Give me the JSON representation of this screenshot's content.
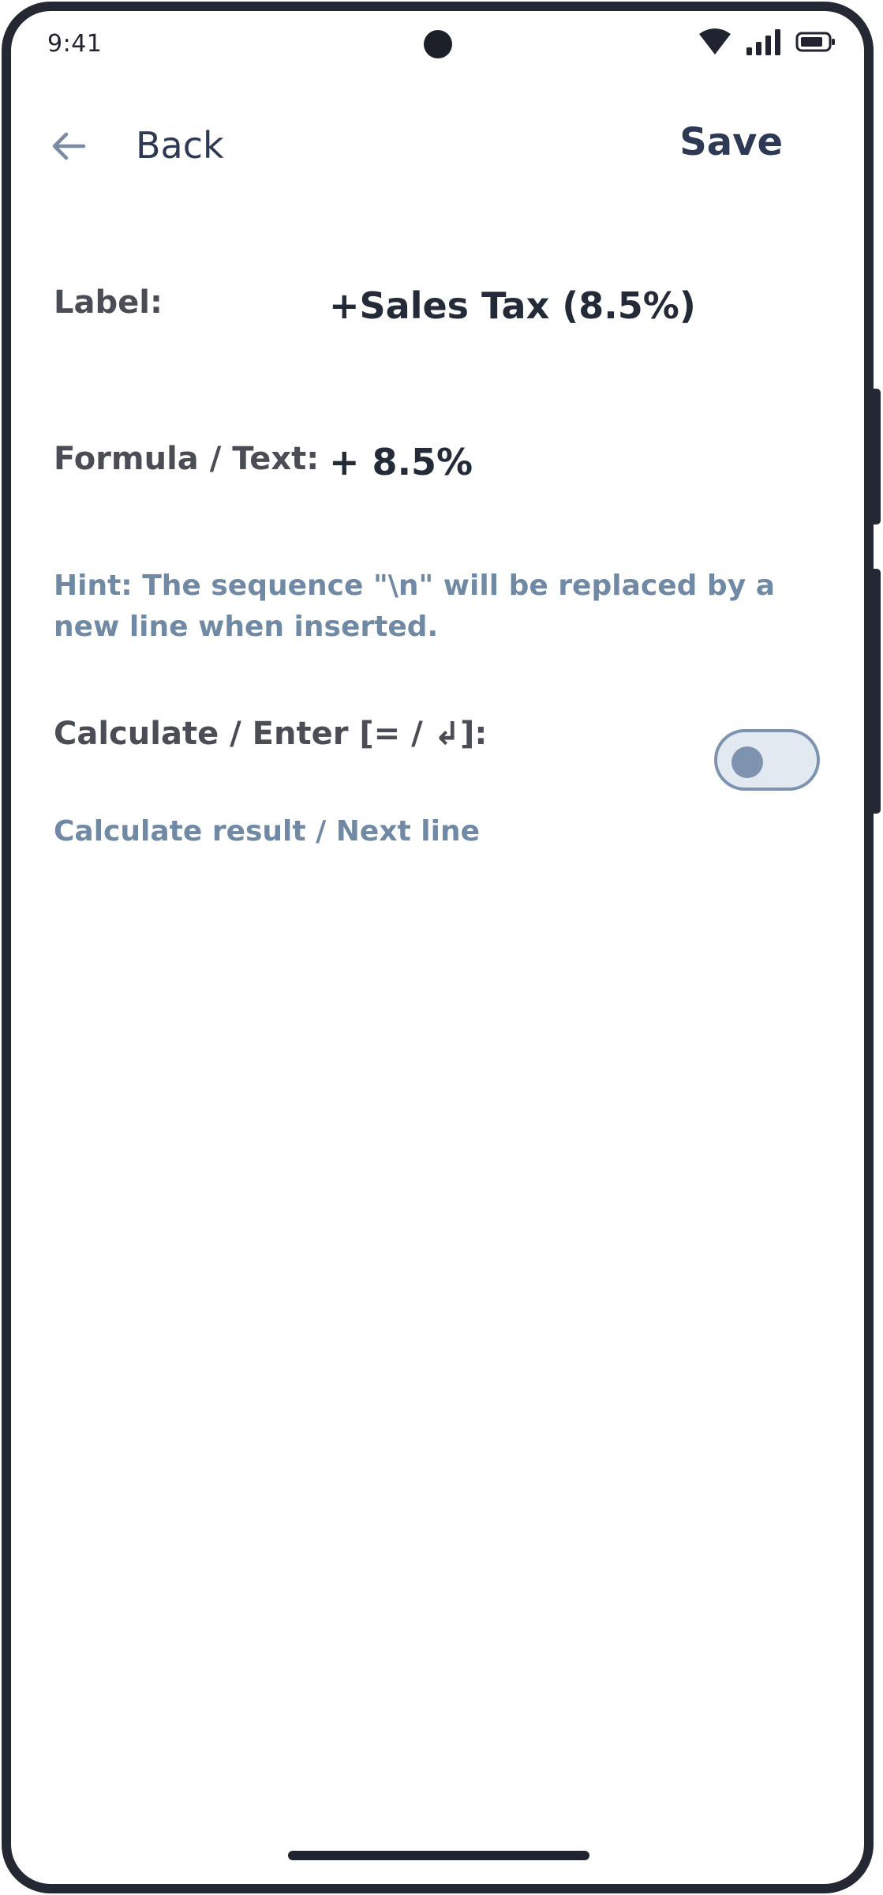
{
  "status_bar": {
    "time": "9:41",
    "icons": [
      "wifi-icon",
      "signal-icon",
      "battery-icon"
    ]
  },
  "header": {
    "back_label": "Back",
    "save_label": "Save"
  },
  "form": {
    "label": {
      "caption": "Label:",
      "value": "+Sales Tax (8.5%)"
    },
    "formula": {
      "caption": "Formula / Text:",
      "value": "+ 8.5%"
    },
    "hint": "Hint: The sequence \"\\n\" will be replaced by a new line when inserted.",
    "calculate": {
      "caption": "Calculate / Enter [= / ↲]:",
      "description": "Calculate result / Next line",
      "enabled": false
    }
  },
  "colors": {
    "primary_text": "#2e3a55",
    "muted_text": "#7089a4",
    "toggle_track": "#e3e9f1",
    "toggle_border": "#7d93b0"
  }
}
